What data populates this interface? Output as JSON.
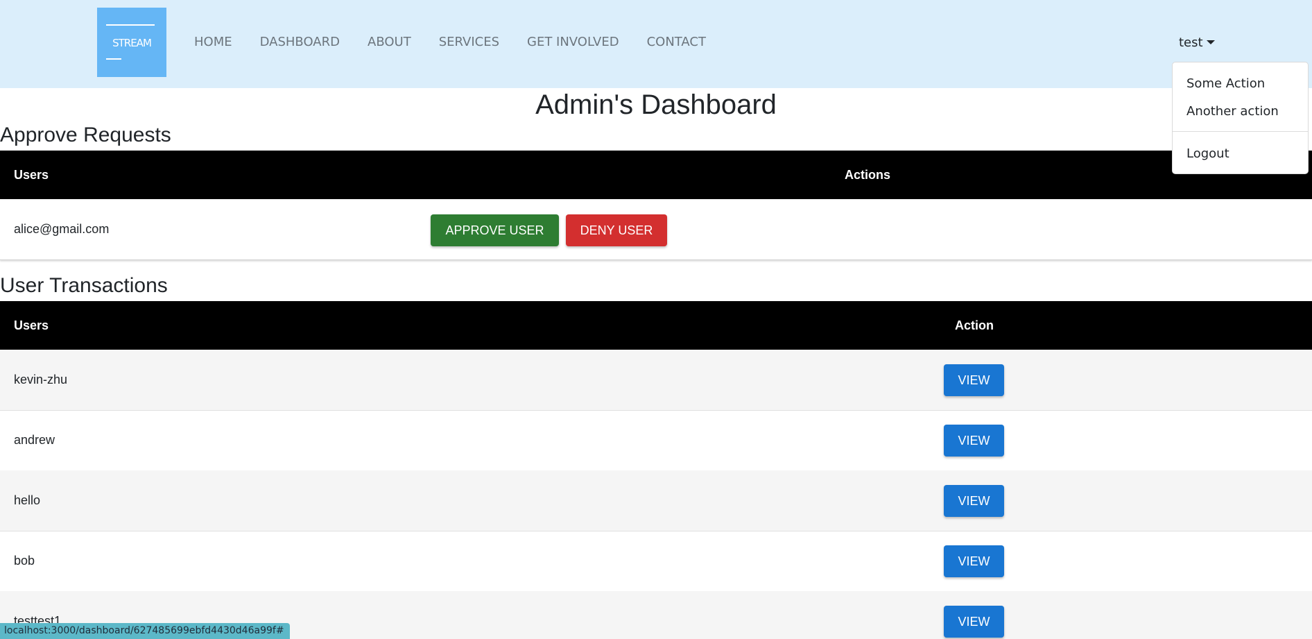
{
  "navbar": {
    "logo_text": "STREAM",
    "links": [
      "HOME",
      "DASHBOARD",
      "ABOUT",
      "SERVICES",
      "GET INVOLVED",
      "CONTACT"
    ],
    "user_menu": {
      "label": "test",
      "items": [
        "Some Action",
        "Another action",
        "Logout"
      ]
    }
  },
  "page": {
    "title": "Admin's Dashboard"
  },
  "approve_requests": {
    "title": "Approve Requests",
    "headers": [
      "Users",
      "Actions"
    ],
    "rows": [
      {
        "email": "alice@gmail.com",
        "approve_label": "APPROVE USER",
        "deny_label": "DENY USER"
      }
    ]
  },
  "user_transactions": {
    "title": "User Transactions",
    "headers": [
      "Users",
      "Action"
    ],
    "rows": [
      {
        "user": "kevin-zhu",
        "action_label": "VIEW"
      },
      {
        "user": "andrew",
        "action_label": "VIEW"
      },
      {
        "user": "hello",
        "action_label": "VIEW"
      },
      {
        "user": "bob",
        "action_label": "VIEW"
      },
      {
        "user": "testtest1",
        "action_label": "VIEW"
      }
    ]
  },
  "status_bar": {
    "url": "localhost:3000/dashboard/627485699ebfd4430d46a99f#"
  },
  "colors": {
    "navbar_bg": "#dbeefb",
    "logo_bg": "#65b6f5",
    "approve": "#2e7d32",
    "deny": "#d32f2f",
    "view": "#1976d2",
    "table_header": "#000000"
  }
}
